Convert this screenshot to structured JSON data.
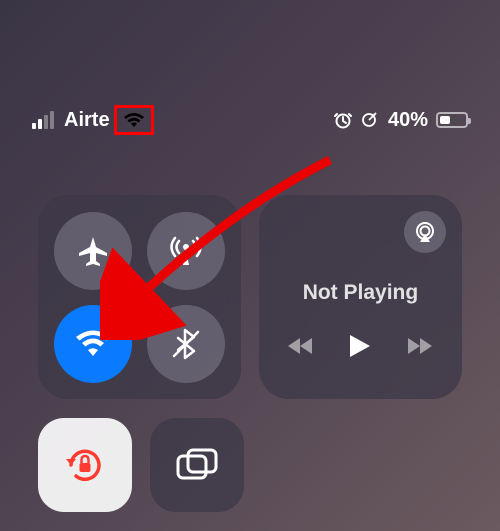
{
  "status": {
    "carrier": "Airte",
    "battery_text": "40%",
    "battery_level": 40
  },
  "media": {
    "title": "Not Playing"
  },
  "icons": {
    "airplane": "airplane-icon",
    "cellular": "cellular-antenna-icon",
    "wifi": "wifi-icon",
    "bluetooth": "bluetooth-icon",
    "airplay": "airplay-icon",
    "rewind": "rewind-icon",
    "play": "play-icon",
    "forward": "forward-icon",
    "rotation_lock": "rotation-lock-icon",
    "screen_mirror": "screen-mirroring-icon",
    "alarm": "alarm-icon",
    "location": "location-icon"
  },
  "states": {
    "wifi_active": true,
    "rotation_lock_active": true
  },
  "colors": {
    "accent_blue": "#0a7aff",
    "accent_red": "#ff3b30",
    "annotation_red": "#ff0000"
  }
}
